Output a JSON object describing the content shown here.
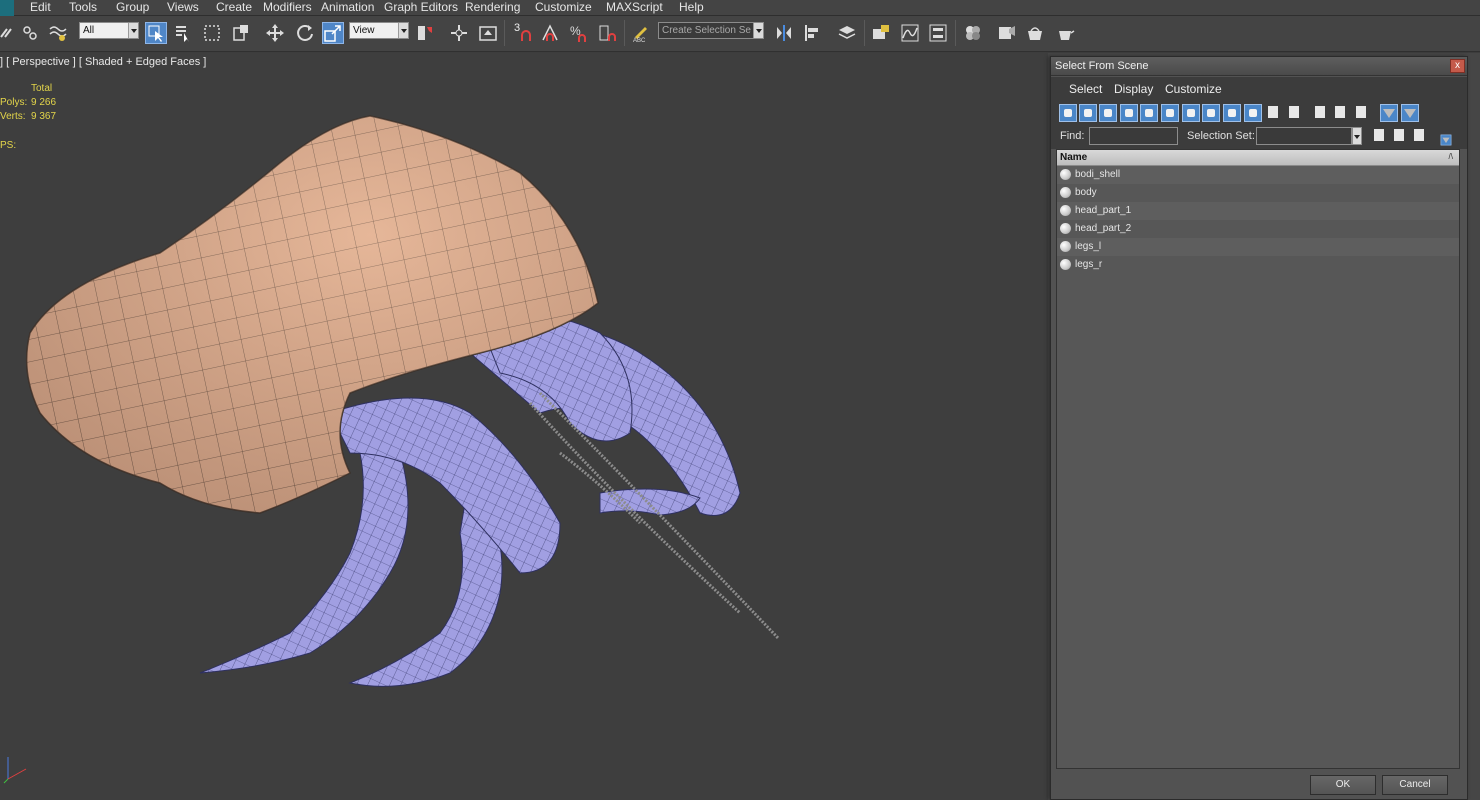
{
  "menubar": {
    "items": [
      "Edit",
      "Tools",
      "Group",
      "Views",
      "Create",
      "Modifiers",
      "Animation",
      "Graph Editors",
      "Rendering",
      "Customize",
      "MAXScript",
      "Help"
    ]
  },
  "toolbar": {
    "filter_dropdown": "All",
    "refcoord_dropdown": "View",
    "selection_set_placeholder": "Create Selection Se",
    "snap_label": "3"
  },
  "viewport": {
    "label": "] [ Perspective ] [ Shaded + Edged Faces ]",
    "stats": {
      "total_label": "Total",
      "polys_label": "Polys:",
      "polys_value": "9 266",
      "verts_label": "Verts:",
      "verts_value": "9 367",
      "fps_label": "PS:"
    }
  },
  "dialog": {
    "title": "Select From Scene",
    "close_glyph": "x",
    "menu": [
      "Select",
      "Display",
      "Customize"
    ],
    "find_label": "Find:",
    "selection_set_label": "Selection Set:",
    "column_header": "Name",
    "sort_glyph": "/\\",
    "objects": [
      "bodi_shell",
      "body",
      "head_part_1",
      "head_part_2",
      "legs_l",
      "legs_r"
    ],
    "ok_label": "OK",
    "cancel_label": "Cancel"
  },
  "colors": {
    "shell": "#d9a98a",
    "body": "#9f9de0",
    "viewport_bg": "#3e3e3e",
    "stats_text": "#e3d54a",
    "selected_tool": "#4f86c7"
  }
}
